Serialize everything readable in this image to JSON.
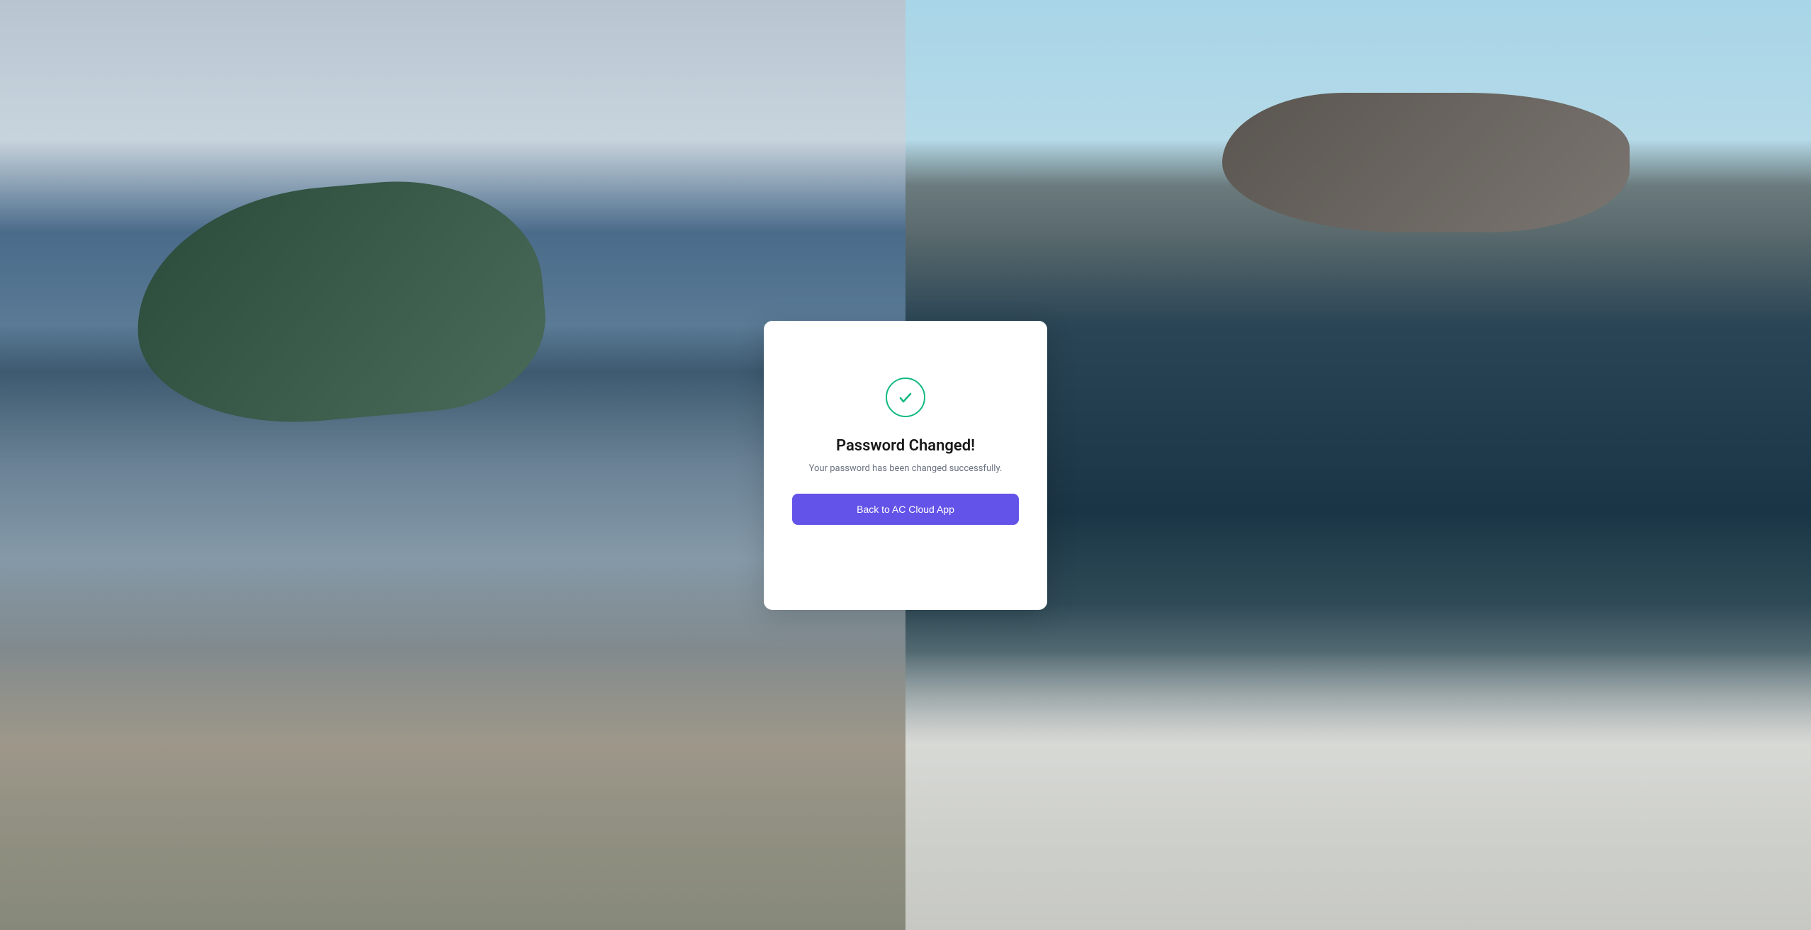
{
  "modal": {
    "title": "Password Changed!",
    "subtitle": "Your password has been changed successfully.",
    "button_label": "Back to AC Cloud App"
  },
  "colors": {
    "success": "#10b981",
    "primary": "#6453e8"
  }
}
